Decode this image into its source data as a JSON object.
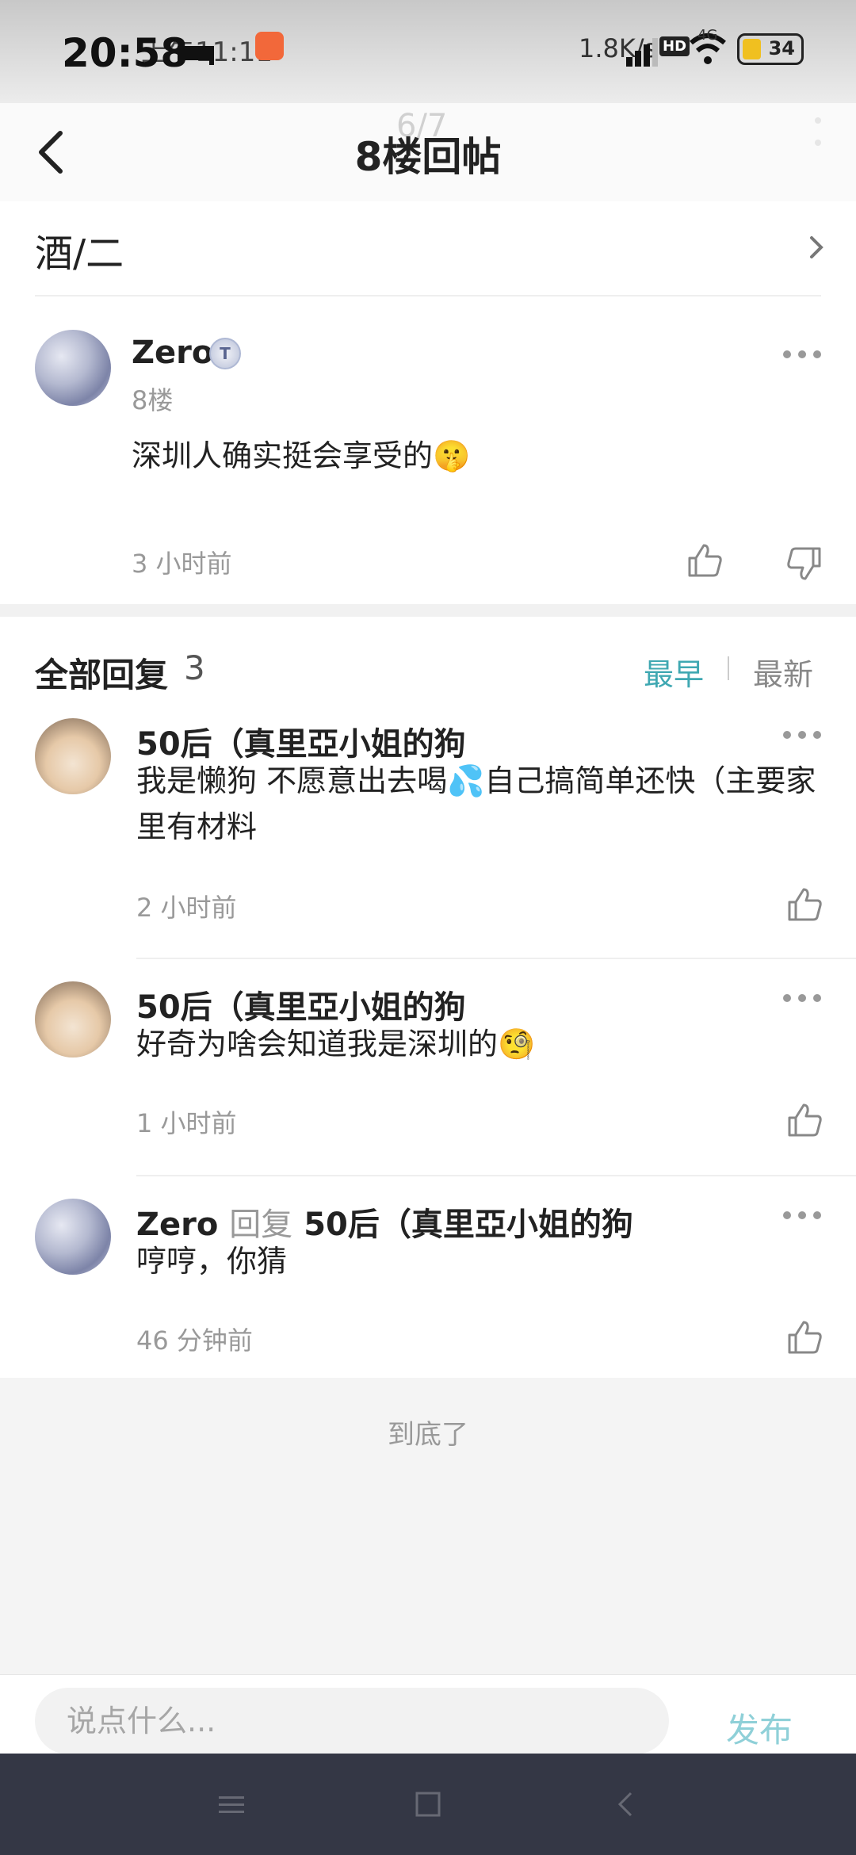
{
  "status_bar": {
    "time": "20:58",
    "ghost_time": "上午11:11",
    "net_speed": "1.8K/s",
    "hd": "HD",
    "network": "4G",
    "battery": "34"
  },
  "header": {
    "title": "8楼回帖",
    "faint_text": "6/7"
  },
  "forum": {
    "name": "酒/二"
  },
  "post": {
    "author": "Zero",
    "badge": "T",
    "floor": "8楼",
    "content": "深圳人确实挺会享受的🤫",
    "time": "3 小时前"
  },
  "replies": {
    "title": "全部回复",
    "count": "3",
    "sort_early": "最早",
    "sort_new": "最新",
    "items": [
      {
        "author": "50后（真里亞小姐的狗",
        "content": "我是懒狗 不愿意出去喝💦自己搞简单还快（主要家里有材料",
        "time": "2 小时前"
      },
      {
        "author": "50后（真里亞小姐的狗",
        "content": "好奇为啥会知道我是深圳的🧐",
        "time": "1 小时前"
      },
      {
        "author": "Zero",
        "reply_word": "回复",
        "reply_to": "50后（真里亞小姐的狗",
        "content": "哼哼，你猜",
        "time": "46 分钟前"
      }
    ],
    "end_note": "到底了"
  },
  "input_bar": {
    "placeholder": "说点什么...",
    "publish": "发布"
  }
}
